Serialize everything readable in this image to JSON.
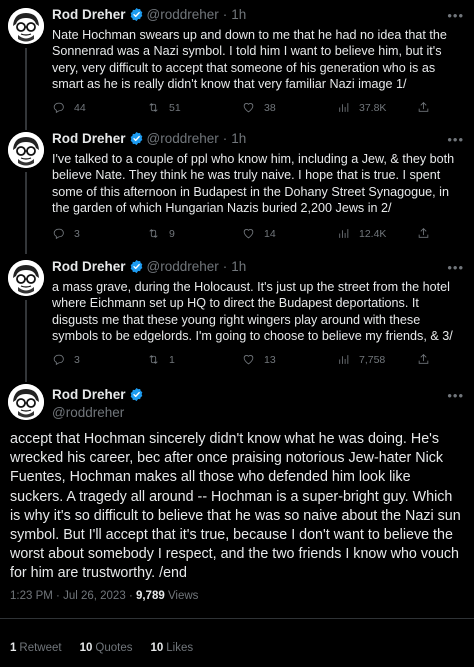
{
  "author": {
    "name": "Rod Dreher",
    "handle": "@roddreher",
    "accent_color": "#1d9bf0"
  },
  "icons": [
    "verified-badge-icon",
    "more-icon",
    "reply-icon",
    "retweet-icon",
    "like-icon",
    "views-icon",
    "share-icon"
  ],
  "tweets": [
    {
      "time": "1h",
      "text": "Nate Hochman swears up and down to me that he had no idea that the Sonnenrad was a Nazi symbol. I told him I want to believe him, but it's very, very difficult to accept that someone of his generation who is as smart as he is really didn't know that very familiar Nazi image 1/",
      "replies": "44",
      "retweets": "51",
      "likes": "38",
      "views": "37.8K"
    },
    {
      "time": "1h",
      "text": "I've talked to a couple of ppl who know him, including a Jew, & they both believe Nate. They think he was truly naive. I hope that is true. I spent some of this afternoon in Budapest in the Dohany Street Synagogue, in the garden of which Hungarian Nazis buried 2,200 Jews in 2/",
      "replies": "3",
      "retweets": "9",
      "likes": "14",
      "views": "12.4K"
    },
    {
      "time": "1h",
      "text": "a mass grave, during the Holocaust. It's just up the street from the hotel where Eichmann set up HQ to direct the Budapest deportations. It disgusts me that these young right wingers play around with these symbols to be edgelords. I'm going to choose to believe my friends, & 3/",
      "replies": "3",
      "retweets": "1",
      "likes": "13",
      "views": "7,758"
    }
  ],
  "main_tweet": {
    "text": "accept that Hochman sincerely didn't know what he was doing. He's wrecked his career, bec after once praising notorious Jew-hater Nick Fuentes, Hochman makes all those who defended him look like suckers. A tragedy all around -- Hochman is a super-bright guy. Which is why it's so difficult to believe that he was so naive about the Nazi sun symbol. But I'll accept that it's true, because I don't want to believe the worst about somebody I respect, and the two friends I know who vouch for him are trustworthy. /end",
    "time": "1:23 PM",
    "date": "Jul 26, 2023",
    "views_count": "9,789",
    "views_label": "Views",
    "retweets_count": "1",
    "retweets_label": "Retweet",
    "quotes_count": "10",
    "quotes_label": "Quotes",
    "likes_count": "10",
    "likes_label": "Likes"
  }
}
